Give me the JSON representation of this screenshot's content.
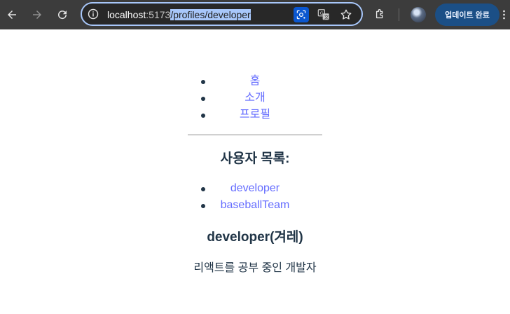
{
  "browser": {
    "url_host": "localhost",
    "url_port": ":5173",
    "url_path": "/profiles/developer",
    "update_button_label": "업데이트 완료",
    "icons": [
      "back-arrow-icon",
      "forward-arrow-icon",
      "reload-icon",
      "site-info-icon",
      "google-lens-icon",
      "translate-icon",
      "bookmark-star-icon",
      "extensions-icon",
      "more-menu-icon"
    ]
  },
  "nav": {
    "items": [
      "홈",
      "소개",
      "프로필"
    ]
  },
  "users": {
    "heading": "사용자 목록:",
    "items": [
      "developer",
      "baseballTeam"
    ]
  },
  "profile": {
    "name": "developer(겨레)",
    "description": "리액트를 공부 중인 개발자"
  },
  "colors": {
    "toolbar": "#3c3c3c",
    "link": "#646cff",
    "text": "#213547",
    "omnibox_border": "#a8c7fa",
    "update_button": "#1b4f86"
  }
}
